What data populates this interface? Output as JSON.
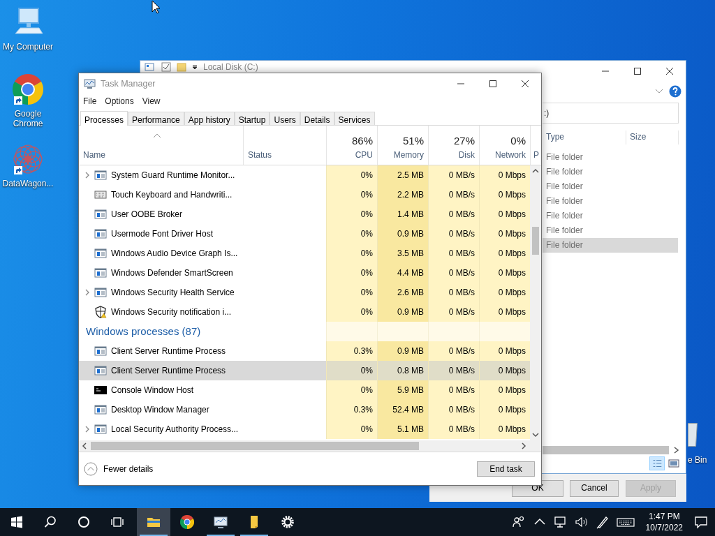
{
  "desktop_icons": [
    {
      "label": "My Computer",
      "kind": "computer",
      "shortcut": false
    },
    {
      "label": "Google Chrome",
      "kind": "chrome",
      "shortcut": true
    },
    {
      "label": "DataWagon...",
      "kind": "mandala",
      "shortcut": true
    },
    {
      "label": "e Bin",
      "kind": "bin"
    }
  ],
  "explorer": {
    "title": "Local Disk (C:)",
    "address": ":)",
    "columns": [
      "Type",
      "Size"
    ],
    "rows": [
      {
        "type": "File folder",
        "selected": false
      },
      {
        "type": "File folder",
        "selected": false
      },
      {
        "type": "File folder",
        "selected": false
      },
      {
        "type": "File folder",
        "selected": false
      },
      {
        "type": "File folder",
        "selected": false
      },
      {
        "type": "File folder",
        "selected": false
      },
      {
        "type": "File folder",
        "selected": true
      }
    ]
  },
  "dialog_buttons": [
    {
      "label": "OK",
      "disabled": false
    },
    {
      "label": "Cancel",
      "disabled": false
    },
    {
      "label": "Apply",
      "disabled": true
    }
  ],
  "task_manager": {
    "title": "Task Manager",
    "menu": [
      "File",
      "Options",
      "View"
    ],
    "tabs": [
      {
        "label": "Processes",
        "selected": true
      },
      {
        "label": "Performance",
        "selected": false
      },
      {
        "label": "App history",
        "selected": false
      },
      {
        "label": "Startup",
        "selected": false
      },
      {
        "label": "Users",
        "selected": false
      },
      {
        "label": "Details",
        "selected": false
      },
      {
        "label": "Services",
        "selected": false
      }
    ],
    "columns": [
      {
        "label": "Name",
        "sorted": true
      },
      {
        "label": "Status"
      },
      {
        "label": "CPU",
        "total": "86%"
      },
      {
        "label": "Memory",
        "total": "51%"
      },
      {
        "label": "Disk",
        "total": "27%"
      },
      {
        "label": "Network",
        "total": "0%"
      },
      {
        "label": "P"
      }
    ],
    "rows": [
      {
        "kind": "app",
        "expandable": true,
        "name": "System Guard Runtime Monitor...",
        "cpu": "0%",
        "memory": "2.5 MB",
        "disk": "0 MB/s",
        "network": "0 Mbps",
        "selected": false
      },
      {
        "kind": "keyboard",
        "expandable": false,
        "name": "Touch Keyboard and Handwriti...",
        "cpu": "0%",
        "memory": "2.2 MB",
        "disk": "0 MB/s",
        "network": "0 Mbps",
        "selected": false
      },
      {
        "kind": "app",
        "expandable": false,
        "name": "User OOBE Broker",
        "cpu": "0%",
        "memory": "1.4 MB",
        "disk": "0 MB/s",
        "network": "0 Mbps",
        "selected": false
      },
      {
        "kind": "app",
        "expandable": false,
        "name": "Usermode Font Driver Host",
        "cpu": "0%",
        "memory": "0.9 MB",
        "disk": "0 MB/s",
        "network": "0 Mbps",
        "selected": false
      },
      {
        "kind": "app",
        "expandable": false,
        "name": "Windows Audio Device Graph Is...",
        "cpu": "0%",
        "memory": "3.5 MB",
        "disk": "0 MB/s",
        "network": "0 Mbps",
        "selected": false
      },
      {
        "kind": "app",
        "expandable": false,
        "name": "Windows Defender SmartScreen",
        "cpu": "0%",
        "memory": "4.4 MB",
        "disk": "0 MB/s",
        "network": "0 Mbps",
        "selected": false
      },
      {
        "kind": "app",
        "expandable": true,
        "name": "Windows Security Health Service",
        "cpu": "0%",
        "memory": "2.6 MB",
        "disk": "0 MB/s",
        "network": "0 Mbps",
        "selected": false
      },
      {
        "kind": "shield",
        "expandable": false,
        "name": "Windows Security notification i...",
        "cpu": "0%",
        "memory": "0.9 MB",
        "disk": "0 MB/s",
        "network": "0 Mbps",
        "selected": false
      },
      {
        "kind": "group",
        "name": "Windows processes (87)",
        "selected": false
      },
      {
        "kind": "app",
        "expandable": false,
        "name": "Client Server Runtime Process",
        "cpu": "0.3%",
        "memory": "0.9 MB",
        "disk": "0 MB/s",
        "network": "0 Mbps",
        "selected": false
      },
      {
        "kind": "app",
        "expandable": false,
        "name": "Client Server Runtime Process",
        "cpu": "0%",
        "memory": "0.8 MB",
        "disk": "0 MB/s",
        "network": "0 Mbps",
        "selected": true
      },
      {
        "kind": "console",
        "expandable": false,
        "name": "Console Window Host",
        "cpu": "0%",
        "memory": "5.9 MB",
        "disk": "0 MB/s",
        "network": "0 Mbps",
        "selected": false
      },
      {
        "kind": "app",
        "expandable": false,
        "name": "Desktop Window Manager",
        "cpu": "0.3%",
        "memory": "52.4 MB",
        "disk": "0 MB/s",
        "network": "0 Mbps",
        "selected": false
      },
      {
        "kind": "app",
        "expandable": true,
        "name": "Local Security Authority Process...",
        "cpu": "0%",
        "memory": "5.1 MB",
        "disk": "0 MB/s",
        "network": "0 Mbps",
        "selected": false
      }
    ],
    "fewer_details": "Fewer details",
    "end_task": "End task"
  },
  "taskbar": {
    "apps": [
      {
        "kind": "start",
        "open": false,
        "active": false
      },
      {
        "kind": "search",
        "open": false,
        "active": false
      },
      {
        "kind": "cortana",
        "open": false,
        "active": false
      },
      {
        "kind": "taskview",
        "open": false,
        "active": false
      },
      {
        "kind": "explorer",
        "open": true,
        "active": true
      },
      {
        "kind": "chrome",
        "open": false,
        "active": false
      },
      {
        "kind": "taskmgr",
        "open": true,
        "active": false
      },
      {
        "kind": "notes",
        "open": true,
        "active": false
      },
      {
        "kind": "settings",
        "open": false,
        "active": false
      }
    ],
    "time": "1:47 PM",
    "date": "10/7/2022"
  }
}
